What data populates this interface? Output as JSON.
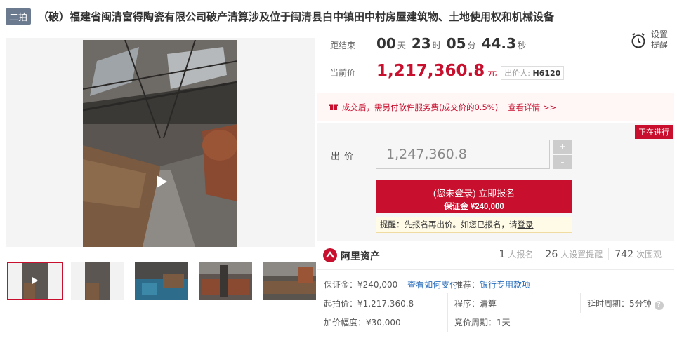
{
  "header": {
    "round_badge": "二拍",
    "title": "（破）福建省闽清富得陶瓷有限公司破产清算涉及位于闽清县白中镇田中村房屋建筑物、土地使用权和机械设备"
  },
  "countdown": {
    "label": "距结束",
    "days": "00",
    "days_unit": "天",
    "hours": "23",
    "hours_unit": "时",
    "minutes": "05",
    "minutes_unit": "分",
    "seconds": "44.3",
    "seconds_unit": "秒"
  },
  "remind": {
    "line1": "设置",
    "line2": "提醒"
  },
  "current_price": {
    "label": "当前价",
    "value": "1,217,360.8",
    "unit": "元",
    "bidder_label": "出价人:",
    "bidder_id": "H6120"
  },
  "notice": {
    "text": "成交后，需另付软件服务费(成交价的0.5%)",
    "link": "查看详情 >>"
  },
  "bid": {
    "status": "正在进行",
    "label": "出价",
    "input_value": "1,247,360.8",
    "plus": "+",
    "minus": "-",
    "signup_main": "(您未登录) 立即报名",
    "signup_sub": "保证金 ¥240,000",
    "tip_prefix": "提醒：先报名再出价。如您已报名，请",
    "tip_link": "登录"
  },
  "platform": {
    "logo_text": "阿里资产",
    "stats": [
      {
        "num": "1",
        "text": "人报名"
      },
      {
        "num": "26",
        "text": "人设置提醒"
      },
      {
        "num": "742",
        "text": "次围观"
      }
    ]
  },
  "details": {
    "deposit": "保证金：¥240,000",
    "deposit_link": "查看如何支付",
    "recommend_label": "推荐：",
    "recommend_link": "银行专用款项",
    "start_price": "起拍价：¥1,217,360.8",
    "procedure": "程序：清算",
    "delay_period": "延时周期：5分钟",
    "increment": "加价幅度：¥30,000",
    "bid_period": "竞价周期：1天"
  },
  "colors": {
    "accent": "#c8102e",
    "link": "#2a6ebb",
    "badge": "#6b7a8f"
  }
}
